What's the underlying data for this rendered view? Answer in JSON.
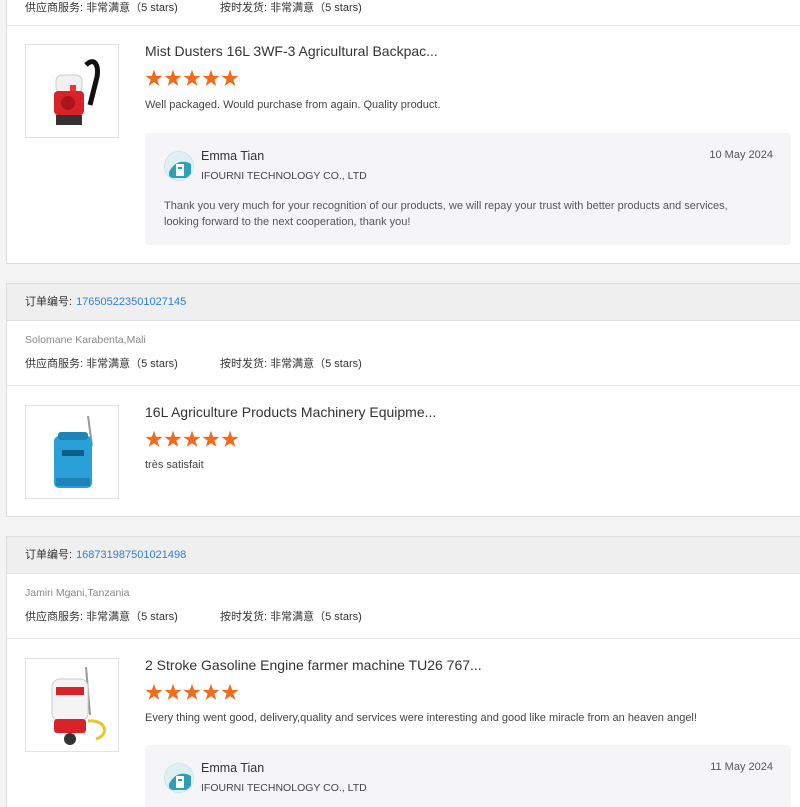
{
  "partial_top": {
    "supplier_service": "供应商服务: 非常满意（5 stars)",
    "on_time_delivery": "按时发货: 非常满意（5 stars)"
  },
  "reviews": [
    {
      "product_title": "Mist Dusters 16L 3WF-3 Agricultural Backpac...",
      "rating": 5,
      "review_text": "Well packaged.  Would purchase from again.  Quality product.",
      "reply": {
        "name": "Emma Tian",
        "company": "IFOURNI TECHNOLOGY CO., LTD",
        "date": "10 May 2024",
        "text": "Thank you very much for your recognition of our products, we will repay your trust with better products and services, looking forward to the next cooperation, thank you!"
      }
    },
    {
      "order_label": "订单编号:",
      "order_number": "176505223501027145",
      "buyer": "Solomane Karabenta,Mali",
      "supplier_service": "供应商服务: 非常满意（5 stars)",
      "on_time_delivery": "按时发货: 非常满意（5 stars)",
      "product_title": "16L Agriculture Products Machinery Equipme...",
      "rating": 5,
      "review_text": "très satisfait"
    },
    {
      "order_label": "订单编号:",
      "order_number": "168731987501021498",
      "buyer": "Jamiri Mgani,Tanzania",
      "supplier_service": "供应商服务: 非常满意（5 stars)",
      "on_time_delivery": "按时发货: 非常满意（5 stars)",
      "product_title": "2 Stroke Gasoline Engine farmer machine TU26 767...",
      "rating": 5,
      "review_text": "Every thing went good, delivery,quality and services were interesting and good like miracle from an heaven angel!",
      "reply": {
        "name": "Emma Tian",
        "company": "IFOURNI TECHNOLOGY CO., LTD",
        "date": "11 May 2024"
      }
    }
  ],
  "colors": {
    "star": "#f26a1b",
    "order_link": "#2f7fd2",
    "order_bar_bg": "#efefef"
  }
}
